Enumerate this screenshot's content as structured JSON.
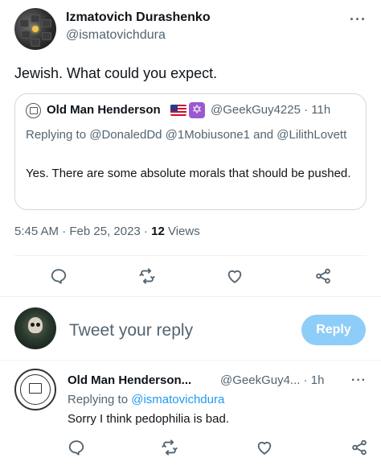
{
  "tweet": {
    "author": {
      "display_name": "Izmatovich Durashenko",
      "handle": "@ismatovichdura"
    },
    "more_label": "···",
    "text": "Jewish. What could you expect.",
    "quote": {
      "display_name": "Old Man Henderson",
      "badges": [
        "us-flag-icon",
        "star-of-david-icon"
      ],
      "star_glyph": "✡",
      "handle_time": "@GeekGuy4225 · 11h",
      "replying": "Replying to @DonaledDd @1Mobiusone1 and @LilithLovett",
      "text": "Yes. There are some absolute morals that should be pushed."
    },
    "meta": {
      "time_date": "5:45 AM · Feb 25, 2023 · ",
      "views_count": "12",
      "views_label": " Views"
    },
    "actions": [
      "reply-icon",
      "retweet-icon",
      "like-icon",
      "share-icon"
    ]
  },
  "composer": {
    "placeholder": "Tweet your reply",
    "button_label": "Reply"
  },
  "reply": {
    "display_name": "Old Man Henderson...",
    "handle_time": "@GeekGuy4... · 1h",
    "more_label": "···",
    "replying_prefix": "Replying to ",
    "replying_mention": "@ismatovichdura",
    "text": "Sorry I think pedophilia is bad.",
    "actions": [
      "reply-icon",
      "retweet-icon",
      "like-icon",
      "share-icon"
    ]
  },
  "colors": {
    "accent": "#1d9bf0",
    "reply_button_disabled": "#8ecdf8",
    "secondary_text": "#536471"
  }
}
